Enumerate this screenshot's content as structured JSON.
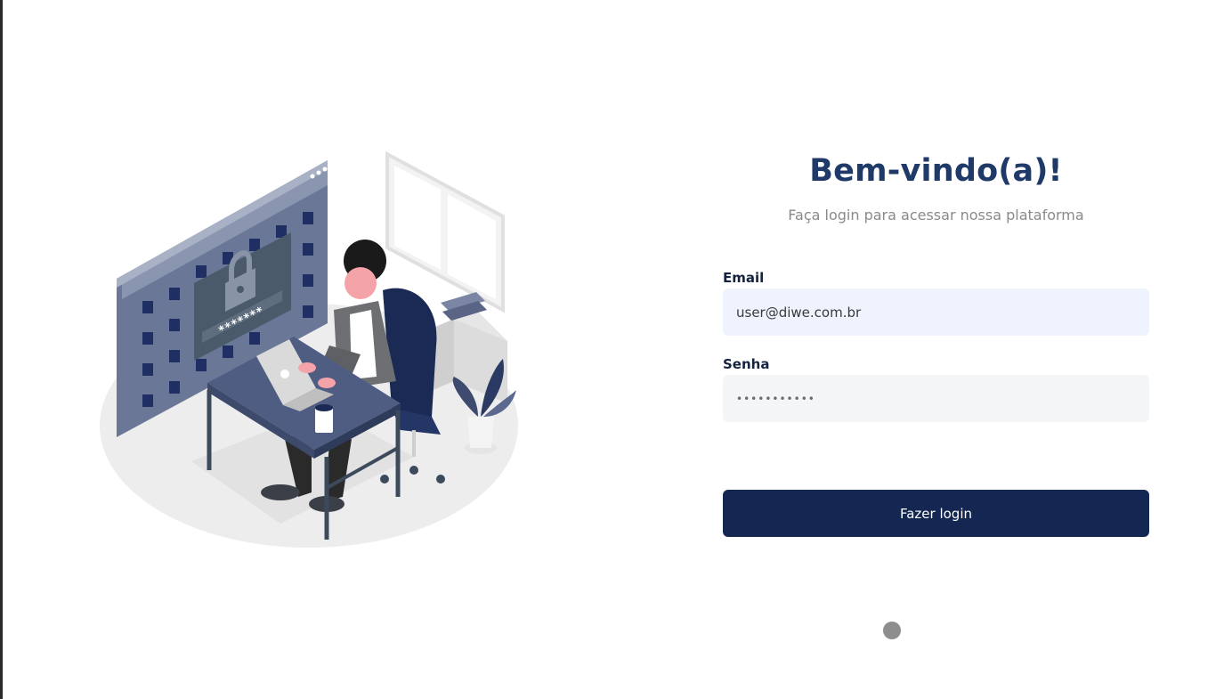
{
  "header": {
    "title": "Bem-vindo(a)!",
    "subtitle": "Faça login para acessar nossa plataforma"
  },
  "form": {
    "email_label": "Email",
    "email_value": "user@diwe.com.br",
    "password_label": "Senha",
    "password_masked": "•••••••••••",
    "submit_label": "Fazer login"
  },
  "illustration": {
    "password_text": "*******"
  },
  "colors": {
    "title": "#1f3a68",
    "button": "#132752",
    "email_bg": "#eef3fd",
    "password_bg": "#f4f5f6",
    "illustration_primary": "#4f5d82",
    "illustration_dark": "#1a2a55"
  }
}
